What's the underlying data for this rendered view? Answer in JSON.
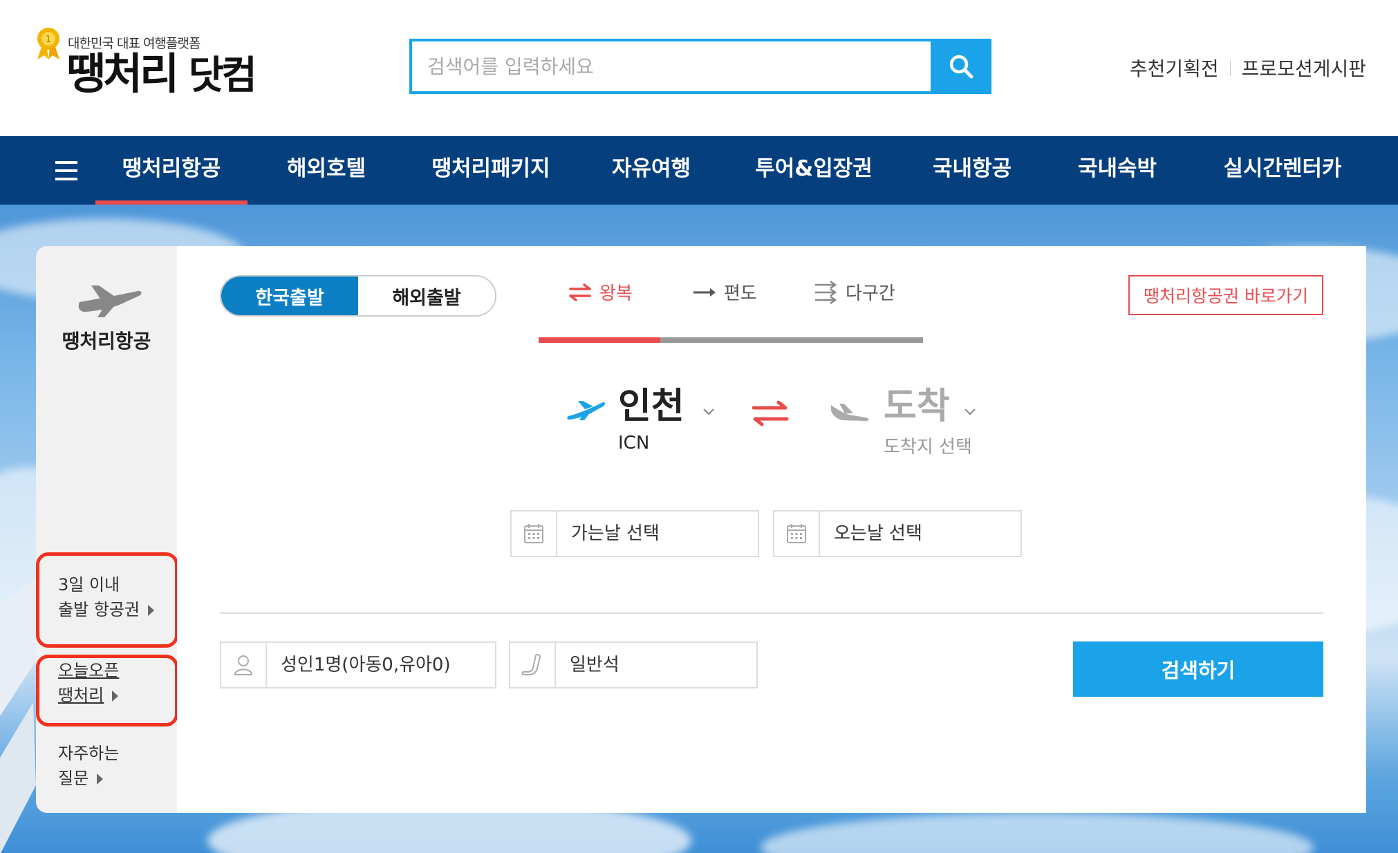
{
  "header": {
    "logo_tagline": "대한민국 대표 여행플랫폼",
    "logo_main": "땡처리",
    "logo_main2": "닷컴",
    "search_placeholder": "검색어를 입력하세요",
    "links": [
      "추천기획전",
      "프로모션게시판"
    ]
  },
  "nav": {
    "items": [
      "땡처리항공",
      "해외호텔",
      "땡처리패키지",
      "자유여행",
      "투어&입장권",
      "국내항공",
      "국내숙박",
      "실시간렌터카"
    ],
    "active": "땡처리항공"
  },
  "side": {
    "title": "땡처리항공",
    "links": [
      {
        "line1": "3일 이내",
        "line2": "출발 항공권"
      },
      {
        "line1": "오늘오픈",
        "line2": "땡처리"
      },
      {
        "line1": "자주하는",
        "line2": "질문"
      }
    ]
  },
  "panel": {
    "departure_toggle": [
      "한국출발",
      "해외출발"
    ],
    "departure_selected": "한국출발",
    "trip_types": [
      "왕복",
      "편도",
      "다구간"
    ],
    "trip_selected": "왕복",
    "shortcut_label": "땡처리항공권 바로가기",
    "origin": {
      "name": "인천",
      "code": "ICN"
    },
    "destination": {
      "name": "도착",
      "code": "도착지 선택"
    },
    "depart_date": "가는날 선택",
    "return_date": "오는날 선택",
    "passengers": "성인1명(아동0,유아0)",
    "cabin": "일반석",
    "search_button": "검색하기"
  },
  "colors": {
    "brand_blue": "#1aa3e8",
    "nav_bg": "#053f7d",
    "accent_red": "#e84c4c",
    "highlight_red": "#f0311e"
  }
}
